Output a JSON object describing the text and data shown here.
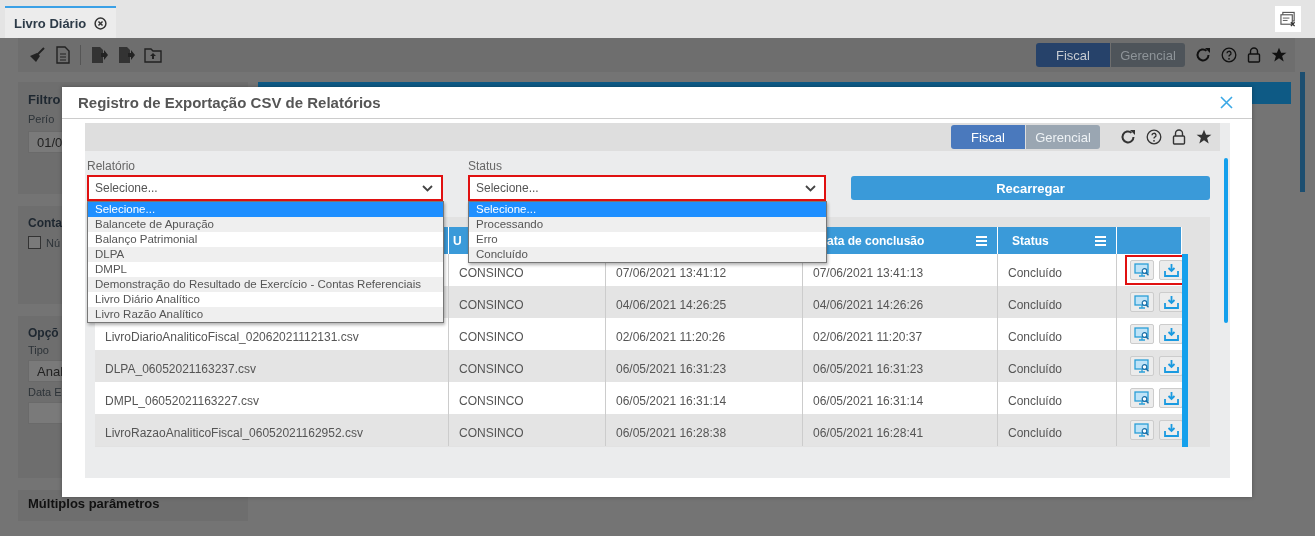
{
  "tab": {
    "label": "Livro Diário"
  },
  "page": {
    "modes": [
      {
        "label": "Fiscal",
        "selected": true
      },
      {
        "label": "Gerencial",
        "selected": false
      }
    ],
    "filter_card": {
      "title": "Filtro",
      "period_label": "Perío",
      "period_value": "01/0"
    },
    "accounts_card": {
      "title": "Conta",
      "option": {
        "label": "Nú",
        "checked": false
      }
    },
    "options_card": {
      "title": "Opçõ",
      "type_label": "Tipo",
      "type_value": "Anal",
      "date_label": "Data E"
    },
    "multi_card": {
      "title": "Múltiplos parâmetros"
    }
  },
  "dialog": {
    "title": "Registro de Exportação CSV de Relatórios",
    "modes": [
      {
        "label": "Fiscal",
        "selected": true
      },
      {
        "label": "Gerencial",
        "selected": false
      }
    ],
    "filters": [
      {
        "label": "Relatório",
        "value": "Selecione...",
        "highlighted": true,
        "expanded": true,
        "options": [
          {
            "label": "Selecione...",
            "selected": true
          },
          {
            "label": "Balancete de Apuração",
            "selected": false
          },
          {
            "label": "Balanço Patrimonial",
            "selected": false
          },
          {
            "label": "DLPA",
            "selected": false
          },
          {
            "label": "DMPL",
            "selected": false
          },
          {
            "label": "Demonstração do Resultado de Exercício - Contas Referenciais",
            "selected": false
          },
          {
            "label": "Livro Diário Analítico",
            "selected": false
          },
          {
            "label": "Livro Razão Analítico",
            "selected": false
          }
        ]
      },
      {
        "label": "Status",
        "value": "Selecione...",
        "highlighted": true,
        "expanded": true,
        "options": [
          {
            "label": "Selecione...",
            "selected": true
          },
          {
            "label": "Processando",
            "selected": false
          },
          {
            "label": "Erro",
            "selected": false
          },
          {
            "label": "Concluído",
            "selected": false
          }
        ]
      }
    ],
    "reload_button": "Recarregar",
    "table": {
      "headers": {
        "column_2": "U",
        "column_4": "ata de conclusão",
        "column_5": "Status"
      },
      "rows": [
        {
          "user": "CONSINCO",
          "started": "07/06/2021 13:41:12",
          "finished": "07/06/2021 13:41:13",
          "status": "Concluído",
          "highlighted": true
        },
        {
          "user": "CONSINCO",
          "started": "04/06/2021 14:26:25",
          "finished": "04/06/2021 14:26:26",
          "status": "Concluído",
          "highlighted": false
        },
        {
          "file": "LivroDiarioAnaliticoFiscal_02062021112131.csv",
          "user": "CONSINCO",
          "started": "02/06/2021 11:20:26",
          "finished": "02/06/2021 11:20:37",
          "status": "Concluído",
          "highlighted": false
        },
        {
          "file": "DLPA_06052021163237.csv",
          "user": "CONSINCO",
          "started": "06/05/2021 16:31:23",
          "finished": "06/05/2021 16:31:23",
          "status": "Concluído",
          "highlighted": false
        },
        {
          "file": "DMPL_06052021163227.csv",
          "user": "CONSINCO",
          "started": "06/05/2021 16:31:14",
          "finished": "06/05/2021 16:31:14",
          "status": "Concluído",
          "highlighted": false
        },
        {
          "file": "LivroRazaoAnaliticoFiscal_06052021162952.csv",
          "user": "CONSINCO",
          "started": "06/05/2021 16:28:38",
          "finished": "06/05/2021 16:28:41",
          "status": "Concluído",
          "highlighted": false
        }
      ]
    }
  }
}
